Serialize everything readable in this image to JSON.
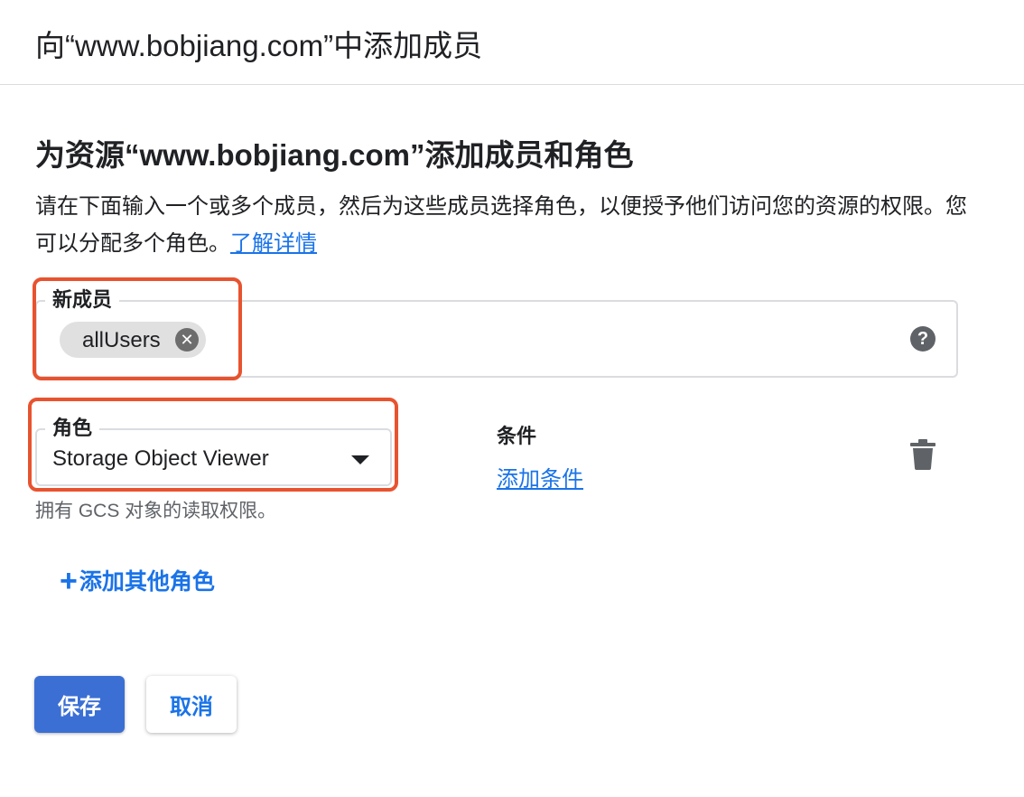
{
  "dialog": {
    "title": "向“www.bobjiang.com”中添加成员"
  },
  "section": {
    "title": "为资源“www.bobjiang.com”添加成员和角色",
    "description": "请在下面输入一个或多个成员，然后为这些成员选择角色，以便授予他们访问您的资源的权限。您可以分配多个角色。",
    "learn_more": "了解详情"
  },
  "members": {
    "label": "新成员",
    "chips": [
      {
        "label": "allUsers",
        "remove_icon": "close-circle-icon"
      }
    ],
    "help_icon": "help-circle-icon",
    "help_glyph": "?"
  },
  "role": {
    "label": "角色",
    "value": "Storage Object Viewer",
    "hint": "拥有 GCS 对象的读取权限。",
    "dropdown_icon": "caret-down-icon"
  },
  "condition": {
    "label": "条件",
    "add_link": "添加条件",
    "delete_icon": "trash-icon"
  },
  "add_role": {
    "plus": "+",
    "label": "添加其他角色"
  },
  "buttons": {
    "save": "保存",
    "cancel": "取消"
  },
  "colors": {
    "primary": "#1a73e8",
    "save_bg": "#3b6fd4",
    "highlight": "#e8532f",
    "chip_bg": "#e0e0e0"
  }
}
